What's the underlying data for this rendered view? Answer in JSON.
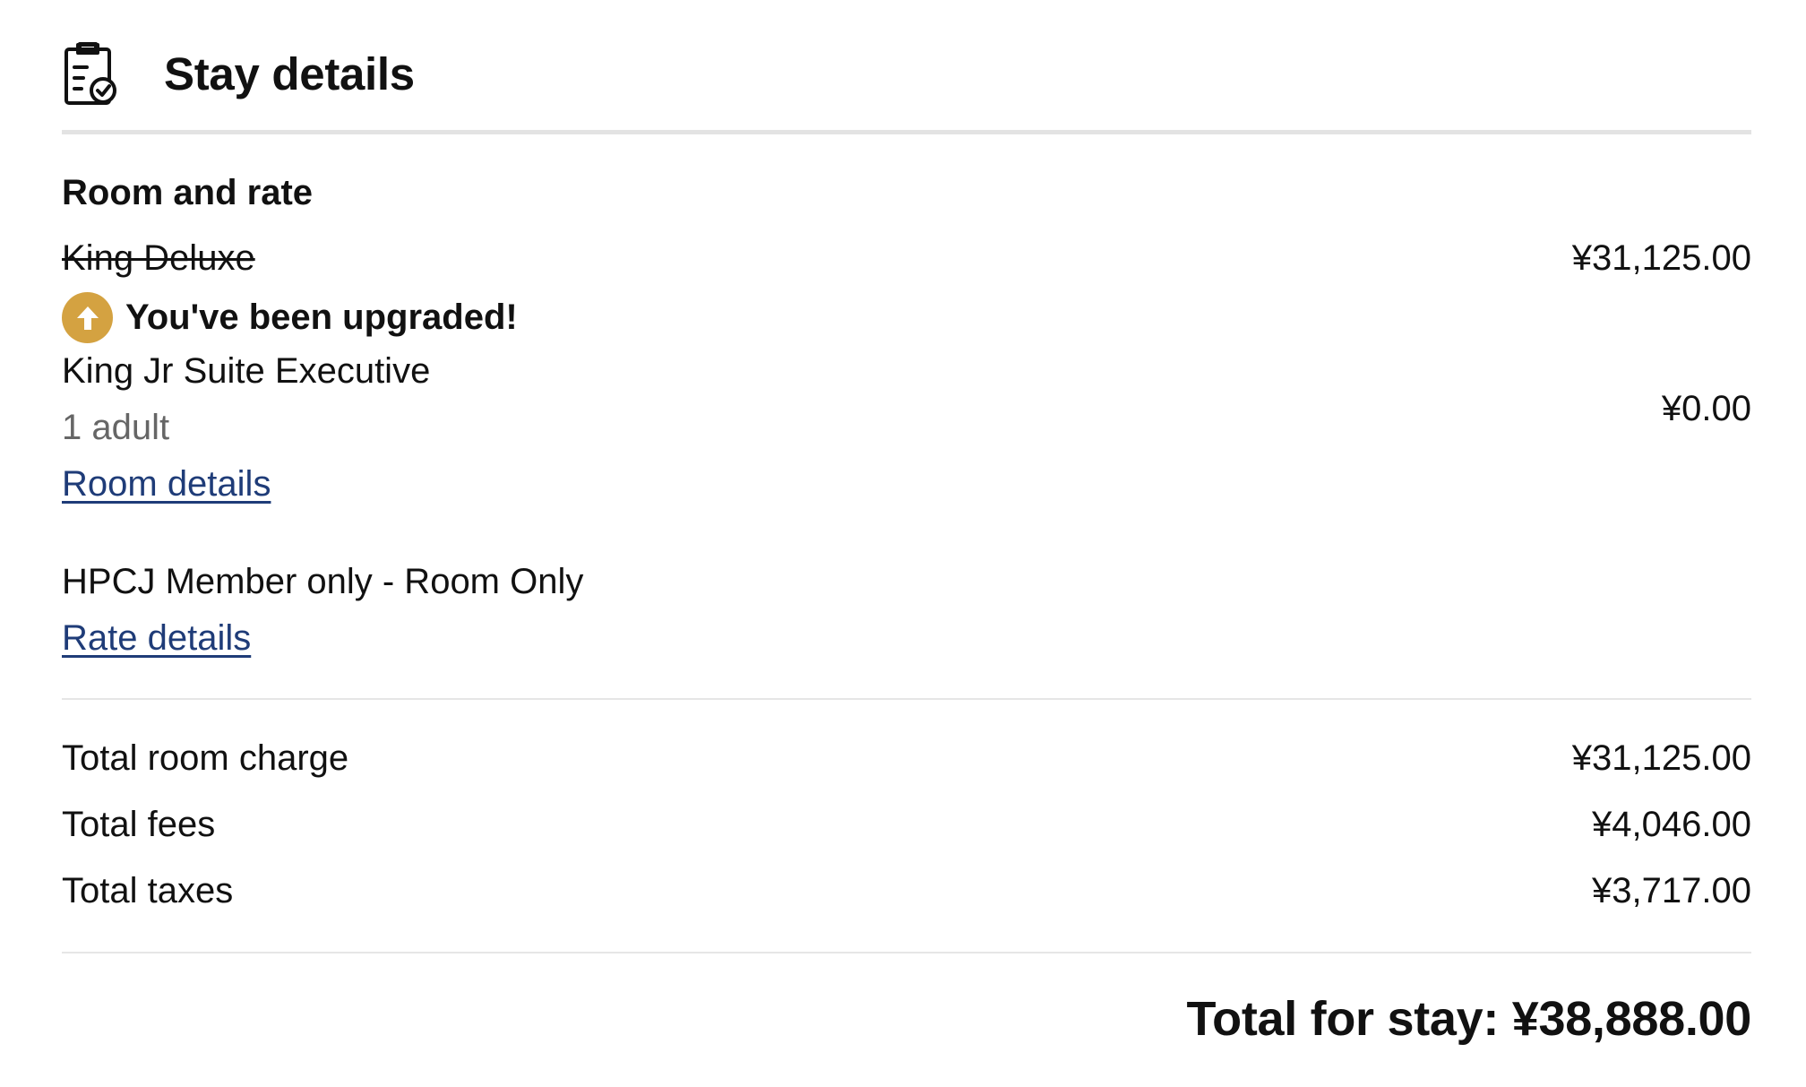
{
  "header": {
    "title": "Stay details",
    "icon": "clipboard-check-icon"
  },
  "room_and_rate": {
    "heading": "Room and rate",
    "original_room": {
      "name": "King Deluxe",
      "price": "¥31,125.00"
    },
    "upgrade": {
      "message": "You've been upgraded!",
      "icon": "arrow-up-icon",
      "badge_color": "#d4a241"
    },
    "upgraded_room": {
      "name": "King Jr Suite Executive",
      "guests": "1 adult",
      "price": "¥0.00",
      "details_link": "Room details"
    },
    "rate": {
      "name": "HPCJ Member only - Room Only",
      "details_link": "Rate details"
    }
  },
  "summary": {
    "room_charge_label": "Total room charge",
    "room_charge_value": "¥31,125.00",
    "fees_label": "Total fees",
    "fees_value": "¥4,046.00",
    "taxes_label": "Total taxes",
    "taxes_value": "¥3,717.00"
  },
  "total": {
    "text": "Total for stay: ¥38,888.00"
  },
  "colors": {
    "link": "#1f3c78",
    "upgrade_badge": "#d4a241",
    "divider": "#e3e3e3"
  }
}
